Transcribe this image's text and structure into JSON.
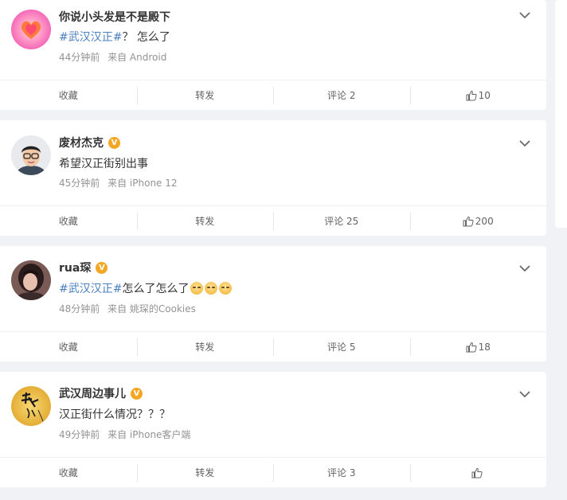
{
  "actions": {
    "collect": "收藏",
    "repost": "转发",
    "comment_prefix": "评论"
  },
  "posts": [
    {
      "name": "你说小头发是不是殿下",
      "verified": false,
      "topic": "#武汉汉正#",
      "text": "？ 怎么了",
      "time": "44分钟前",
      "source": "来自 Android",
      "comment_label": "评论 2",
      "likes": "10",
      "avatar": "heart-avatar"
    },
    {
      "name": "废材杰克",
      "verified": true,
      "topic": "",
      "text": "希望汉正街别出事",
      "time": "45分钟前",
      "source": "来自 iPhone 12",
      "comment_label": "评论 25",
      "likes": "200",
      "avatar": "cartoon-man-avatar"
    },
    {
      "name": "rua琛",
      "verified": true,
      "topic": "#武汉汉正#",
      "text": "怎么了怎么了",
      "time": "48分钟前",
      "source": "来自 姚琛的Cookies",
      "comment_label": "评论 5",
      "likes": "18",
      "avatar": "photo-avatar"
    },
    {
      "name": "武汉周边事儿",
      "verified": true,
      "topic": "",
      "text": "汉正街什么情况？？？",
      "time": "49分钟前",
      "source": "来自 iPhone客户端",
      "comment_label": "评论 3",
      "likes": "",
      "avatar": "calligraphy-avatar"
    }
  ]
}
